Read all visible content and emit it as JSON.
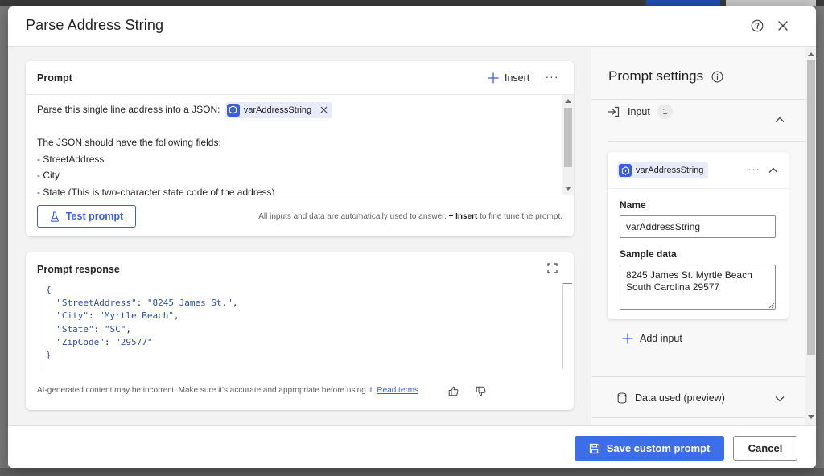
{
  "dialog": {
    "title": "Parse Address String",
    "help_icon": "help-circle-icon",
    "close_icon": "close-icon"
  },
  "prompt_card": {
    "title": "Prompt",
    "insert_label": "Insert",
    "more_label": "···",
    "text_before_chip": "Parse this single line address into a JSON:",
    "chip_label": "varAddressString",
    "lines": [
      "The JSON should have the following fields:",
      "- StreetAddress",
      "- City",
      "- State (This is two-character state code of the address)"
    ],
    "test_button": "Test prompt",
    "hint_before": "All inputs and data are automatically used to answer.",
    "hint_plus": "+",
    "hint_bold": "Insert",
    "hint_after": "to fine tune the prompt."
  },
  "response_card": {
    "title": "Prompt response",
    "code": {
      "open": "{",
      "close": "}",
      "fields": [
        {
          "key": "\"StreetAddress\"",
          "value": "\"8245 James St.\"",
          "trail": ","
        },
        {
          "key": "\"City\"",
          "value": "\"Myrtle Beach\"",
          "trail": ","
        },
        {
          "key": "\"State\"",
          "value": "\"SC\"",
          "trail": ","
        },
        {
          "key": "\"ZipCode\"",
          "value": "\"29577\"",
          "trail": ""
        }
      ]
    },
    "disclaimer": "AI-generated content may be incorrect. Make sure it's accurate and appropriate before using it.",
    "read_terms": "Read terms"
  },
  "settings": {
    "title": "Prompt settings",
    "input_section": "Input",
    "input_count": "1",
    "input_card": {
      "chip_label": "varAddressString",
      "more_label": "···",
      "name_label": "Name",
      "name_value": "varAddressString",
      "sample_label": "Sample data",
      "sample_value": "8245 James St. Myrtle Beach South Carolina 29577"
    },
    "add_input": "Add input",
    "data_used": "Data used (preview)"
  },
  "footer": {
    "save_label": "Save custom prompt",
    "cancel_label": "Cancel"
  },
  "colors": {
    "accent": "#3b6ee8",
    "chip_bg": "#e8ebf9",
    "chip_icon": "#3b5fd9"
  }
}
